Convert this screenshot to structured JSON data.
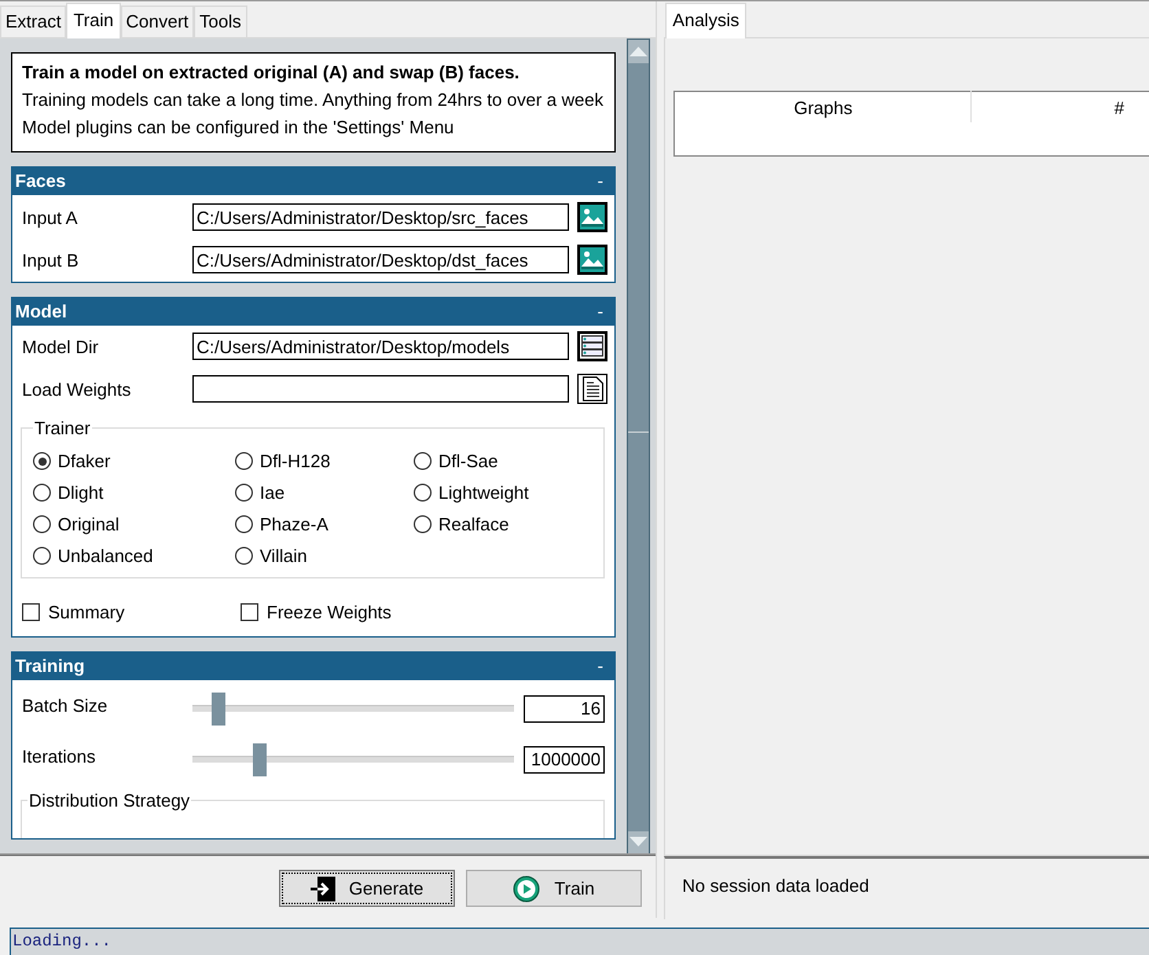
{
  "left_tabs": [
    {
      "label": "Extract",
      "selected": false
    },
    {
      "label": "Train",
      "selected": true
    },
    {
      "label": "Convert",
      "selected": false
    },
    {
      "label": "Tools",
      "selected": false
    }
  ],
  "info": {
    "title": "Train a model on extracted original (A) and swap (B) faces.",
    "lines": [
      "Training models can take a long time. Anything from 24hrs to over a week",
      "Model plugins can be configured in the 'Settings' Menu"
    ]
  },
  "faces": {
    "title": "Faces",
    "collapse": "-",
    "rows": [
      {
        "label": "Input A",
        "value": "C:/Users/Administrator/Desktop/src_faces",
        "kind": "image"
      },
      {
        "label": "Input B",
        "value": "C:/Users/Administrator/Desktop/dst_faces",
        "kind": "image"
      }
    ]
  },
  "model": {
    "title": "Model",
    "collapse": "-",
    "rows": [
      {
        "label": "Model Dir",
        "value": "C:/Users/Administrator/Desktop/models",
        "kind": "folder"
      },
      {
        "label": "Load Weights",
        "value": "",
        "kind": "file"
      }
    ],
    "trainer": {
      "title": "Trainer",
      "options": [
        {
          "label": "Dfaker",
          "selected": true
        },
        {
          "label": "Dfl-H128",
          "selected": false
        },
        {
          "label": "Dfl-Sae",
          "selected": false
        },
        {
          "label": "Dlight",
          "selected": false
        },
        {
          "label": "Iae",
          "selected": false
        },
        {
          "label": "Lightweight",
          "selected": false
        },
        {
          "label": "Original",
          "selected": false
        },
        {
          "label": "Phaze-A",
          "selected": false
        },
        {
          "label": "Realface",
          "selected": false
        },
        {
          "label": "Unbalanced",
          "selected": false
        },
        {
          "label": "Villain",
          "selected": false
        }
      ]
    },
    "checkboxes": [
      {
        "label": "Summary",
        "checked": false
      },
      {
        "label": "Freeze Weights",
        "checked": false
      }
    ]
  },
  "training": {
    "title": "Training",
    "collapse": "-",
    "sliders": [
      {
        "label": "Batch Size",
        "level": 0.08,
        "value": "16"
      },
      {
        "label": "Iterations",
        "level": 0.21,
        "value": "1000000"
      }
    ],
    "group_title": "Distribution Strategy"
  },
  "buttons": [
    {
      "label": "Generate",
      "kind": "generate",
      "focused": true
    },
    {
      "label": "Train",
      "kind": "train",
      "focused": false
    }
  ],
  "right_tabs": [
    {
      "label": "Analysis",
      "selected": true
    }
  ],
  "table": {
    "columns": [
      "Graphs",
      "#"
    ]
  },
  "status": "No session data loaded",
  "log": [
    "Loading..."
  ]
}
